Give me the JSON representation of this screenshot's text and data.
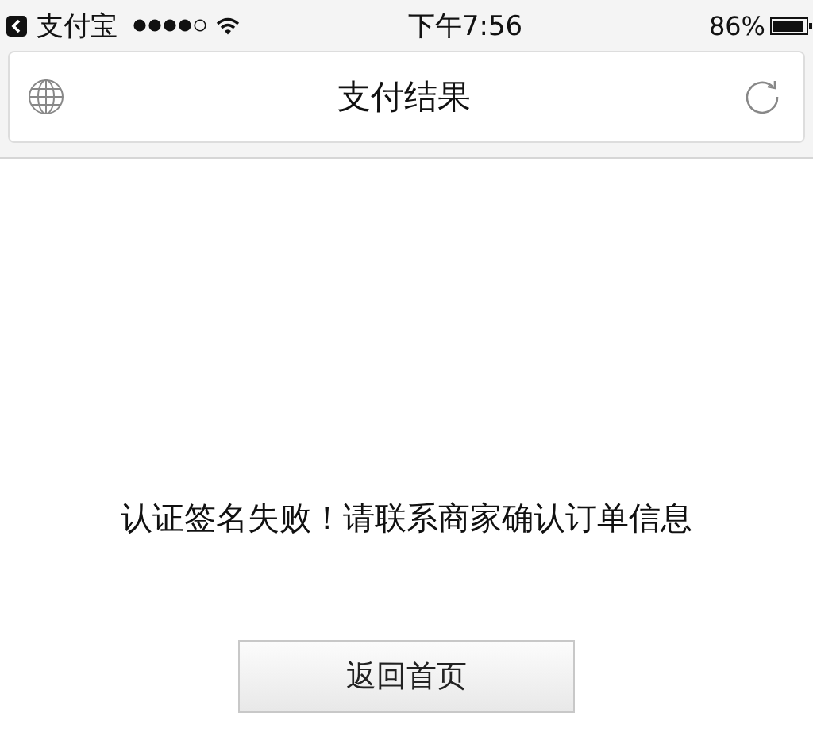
{
  "status_bar": {
    "back_app": "支付宝",
    "time": "下午7:56",
    "battery": "86%"
  },
  "nav_bar": {
    "title": "支付结果"
  },
  "message": "认证签名失败！请联系商家确认订单信息",
  "buttons": [
    {
      "label": "返回首页"
    }
  ]
}
